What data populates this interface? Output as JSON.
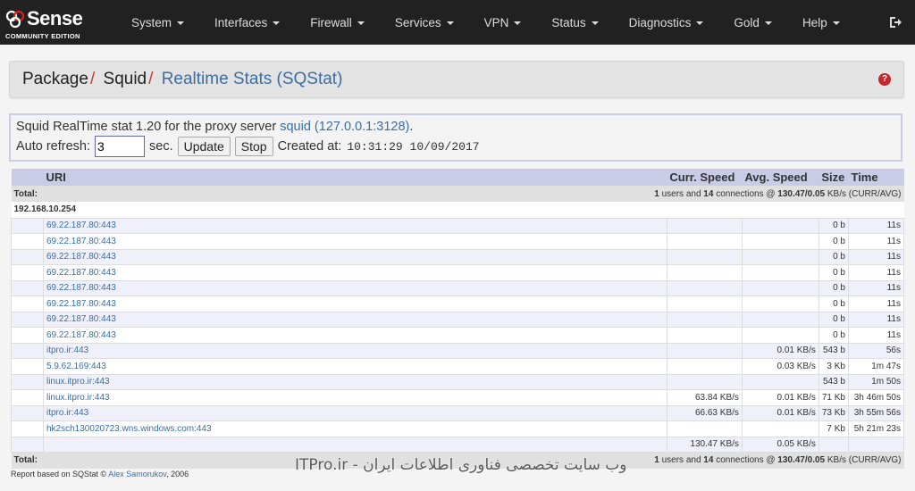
{
  "navbar": {
    "brand_word": "Sense",
    "brand_sub": "COMMUNITY EDITION",
    "menu": [
      "System",
      "Interfaces",
      "Firewall",
      "Services",
      "VPN",
      "Status",
      "Diagnostics",
      "Gold",
      "Help"
    ]
  },
  "breadcrumb": {
    "parts": [
      "Package",
      "Squid"
    ],
    "separator": "/",
    "current": "Realtime Stats (SQStat)"
  },
  "info": {
    "line1_prefix": "Squid RealTime stat 1.20 for the proxy server ",
    "server_link": "squid (127.0.0.1:3128)",
    "line1_suffix": ".",
    "auto_refresh_label": "Auto refresh:",
    "auto_refresh_value": "3",
    "sec_label": "sec.",
    "update_label": "Update",
    "stop_label": "Stop",
    "created_label": "Created at:",
    "created_value": "10:31:29 10/09/2017"
  },
  "table": {
    "headers": {
      "uri": "URI",
      "curr_speed": "Curr. Speed",
      "avg_speed": "Avg. Speed",
      "size": "Size",
      "time": "Time"
    },
    "total_label": "Total:",
    "summary": {
      "users": "1",
      "users_label": " users and ",
      "connections": "14",
      "connections_label": " connections @ ",
      "speed": "130.47/0.05",
      "speed_label": " KB/s (CURR/AVG)"
    },
    "host": "192.168.10.254",
    "rows": [
      {
        "uri": "69.22.187.80:443",
        "curr": "",
        "avg": "",
        "size": "0 b",
        "time": "11s"
      },
      {
        "uri": "69.22.187.80:443",
        "curr": "",
        "avg": "",
        "size": "0 b",
        "time": "11s"
      },
      {
        "uri": "69.22.187.80:443",
        "curr": "",
        "avg": "",
        "size": "0 b",
        "time": "11s"
      },
      {
        "uri": "69.22.187.80:443",
        "curr": "",
        "avg": "",
        "size": "0 b",
        "time": "11s"
      },
      {
        "uri": "69.22.187.80:443",
        "curr": "",
        "avg": "",
        "size": "0 b",
        "time": "11s"
      },
      {
        "uri": "69.22.187.80:443",
        "curr": "",
        "avg": "",
        "size": "0 b",
        "time": "11s"
      },
      {
        "uri": "69.22.187.80:443",
        "curr": "",
        "avg": "",
        "size": "0 b",
        "time": "11s"
      },
      {
        "uri": "69.22.187.80:443",
        "curr": "",
        "avg": "",
        "size": "0 b",
        "time": "11s"
      },
      {
        "uri": "itpro.ir:443",
        "curr": "",
        "avg": "0.01 KB/s",
        "size": "543 b",
        "time": "56s"
      },
      {
        "uri": "5.9.62.169:443",
        "curr": "",
        "avg": "0.03 KB/s",
        "size": "3 Kb",
        "time": "1m 47s"
      },
      {
        "uri": "linux.itpro.ir:443",
        "curr": "",
        "avg": "",
        "size": "543 b",
        "time": "1m 50s"
      },
      {
        "uri": "linux.itpro.ir:443",
        "curr": "63.84 KB/s",
        "avg": "0.01 KB/s",
        "size": "71 Kb",
        "time": "3h 46m 50s"
      },
      {
        "uri": "itpro.ir:443",
        "curr": "66.63 KB/s",
        "avg": "0.01 KB/s",
        "size": "73 Kb",
        "time": "3h 55m 56s"
      },
      {
        "uri": "hk2sch130020723.wns.windows.com:443",
        "curr": "",
        "avg": "",
        "size": "7 Kb",
        "time": "5h 21m 23s"
      }
    ],
    "subtotal": {
      "curr": "130.47 KB/s",
      "avg": "0.05 KB/s"
    }
  },
  "footer": {
    "prefix": "Report based on SQStat © ",
    "author": "Alex Samorukov",
    "suffix": ", 2006"
  },
  "watermark": "ITPro.ir - وب سایت تخصصی فناوری اطلاعات ایران",
  "colors": {
    "navbar": "#212121",
    "accent_red": "#d9201e",
    "link": "#3a6ea5",
    "table_head": "#c9cce6"
  }
}
